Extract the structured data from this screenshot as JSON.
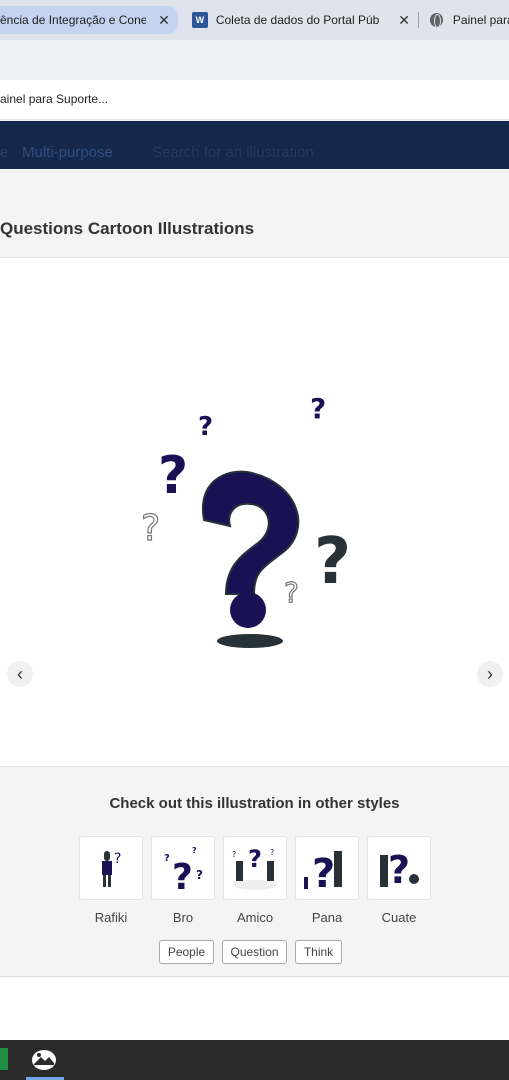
{
  "browser": {
    "tabs": [
      {
        "title": "ência de Integração e Conex",
        "active": true
      },
      {
        "title": "Coleta de dados do Portal Públic",
        "icon": "word-icon"
      },
      {
        "title": "Painel para",
        "icon": "globe-icon"
      }
    ],
    "close_glyph": "✕",
    "word_icon_letter": "W",
    "bookmark": "ainel para Suporte..."
  },
  "site_header": {
    "nav_partial": "e",
    "nav_item": "Multi-purpose",
    "search_placeholder": "Search for an illustration"
  },
  "page": {
    "title": "Questions Cartoon Illustrations",
    "prev_glyph": "‹",
    "next_glyph": "›"
  },
  "other_styles": {
    "heading": "Check out this illustration in other styles",
    "styles": [
      "Rafiki",
      "Bro",
      "Amico",
      "Pana",
      "Cuate"
    ]
  },
  "tags": [
    "People",
    "Question",
    "Think"
  ],
  "colors": {
    "header_bg": "#13284a",
    "illustration_primary": "#1a1054",
    "illustration_secondary": "#263238"
  }
}
